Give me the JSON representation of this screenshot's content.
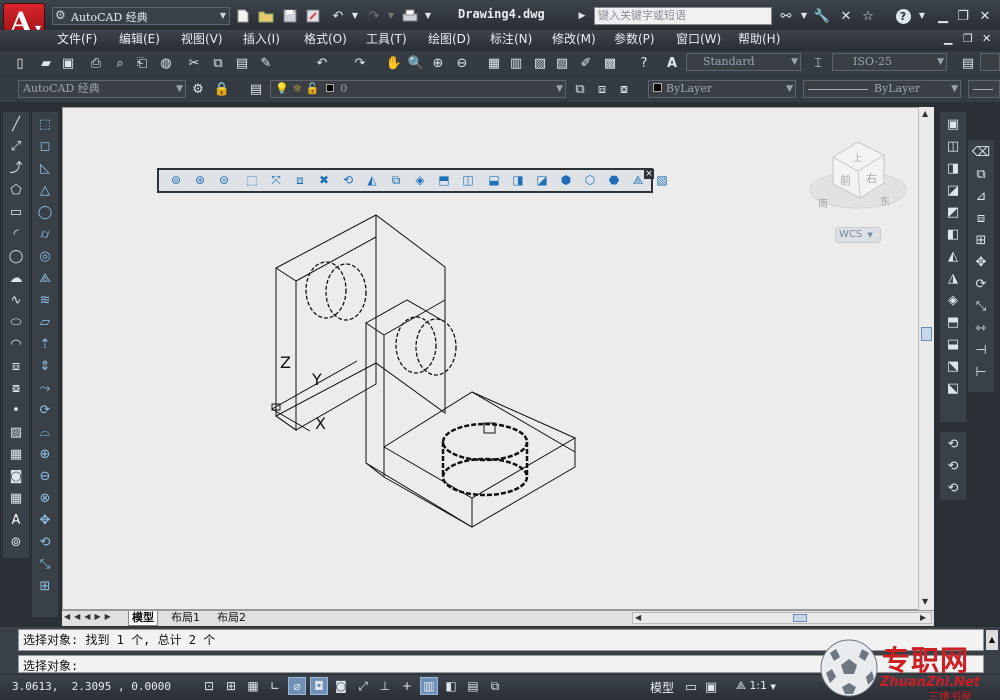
{
  "title_bar": {
    "workspace": "AutoCAD 经典",
    "document": "Drawing4.dwg",
    "search_placeholder": "键入关键字或短语"
  },
  "menu": [
    "文件(F)",
    "编辑(E)",
    "视图(V)",
    "插入(I)",
    "格式(O)",
    "工具(T)",
    "绘图(D)",
    "标注(N)",
    "修改(M)",
    "参数(P)",
    "窗口(W)",
    "帮助(H)"
  ],
  "toolbar2": {
    "text_style": "Standard",
    "dim_style": "ISO-25"
  },
  "toolbar3": {
    "workspace": "AutoCAD 经典",
    "layer": "0",
    "color": "ByLayer",
    "linetype": "ByLayer"
  },
  "viewcube": {
    "top": "上",
    "front": "前",
    "right": "右",
    "south": "南",
    "east": "东",
    "wcs": "WCS"
  },
  "axes": {
    "x": "X",
    "y": "Y",
    "z": "Z"
  },
  "layout_tabs": [
    "模型",
    "布局1",
    "布局2"
  ],
  "command_lines": [
    "选择对象: 找到 1 个, 总计 2 个",
    "选择对象:"
  ],
  "status": {
    "coords": "3.0613,  2.3095 , 0.0000",
    "model": "模型",
    "scale": "1:1"
  },
  "watermark": {
    "brand": "专职网",
    "site": "ZhuanZhi.Net",
    "sub": "三维书屋"
  },
  "colors": {
    "background": "#2b3036",
    "canvas": "#ececec",
    "accent": "#c0141b"
  }
}
